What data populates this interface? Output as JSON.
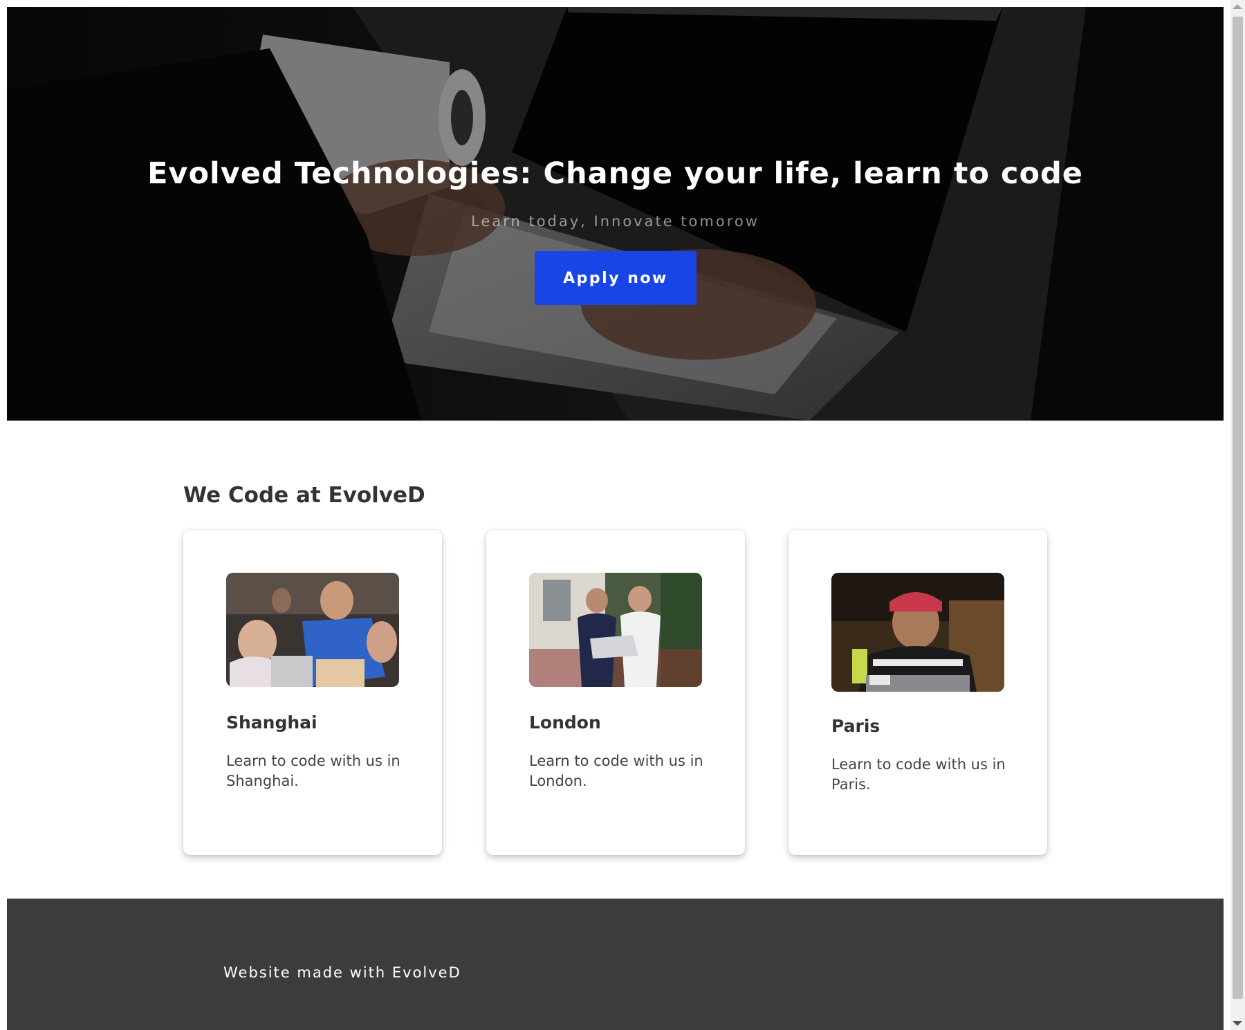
{
  "hero": {
    "title": "Evolved Technologies: Change your life, learn to code",
    "subtitle": "Learn today, Innovate tomorow",
    "apply_label": "Apply now"
  },
  "main": {
    "section_title": "We Code at EvolveD",
    "cards": [
      {
        "title": "Shanghai",
        "text": "Learn to code with us in Shanghai."
      },
      {
        "title": "London",
        "text": "Learn to code with us in London."
      },
      {
        "title": "Paris",
        "text": "Learn to code with us in Paris."
      }
    ]
  },
  "footer": {
    "text": "Website made with EvolveD"
  },
  "colors": {
    "accent": "#1a45e6",
    "footer_bg": "#3c3c3f",
    "heading": "#333333"
  },
  "icons": {
    "hero_image": "laptop-coding-photo",
    "card_images": [
      "group-laptops-photo",
      "two-men-laptop-photo",
      "student-laptop-photo"
    ]
  }
}
